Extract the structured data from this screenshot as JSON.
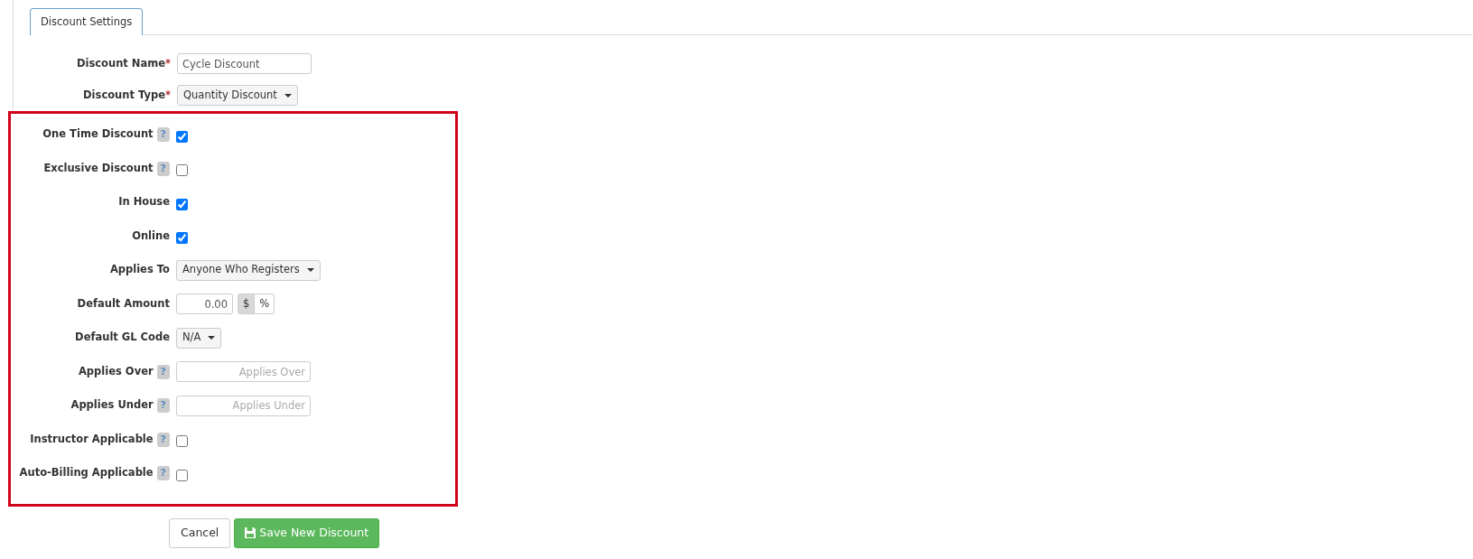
{
  "tabs": [
    {
      "label": "Discount Settings",
      "selected": true
    }
  ],
  "fields": [
    {
      "kind": "text",
      "label": "Discount Name",
      "required_mark": "*",
      "value": "Cycle Discount"
    },
    {
      "kind": "select",
      "label": "Discount Type",
      "required_mark": "*",
      "value": "Quantity Discount"
    }
  ],
  "highlighted_section": {
    "fields": [
      {
        "kind": "checkbox",
        "label": "One Time Discount",
        "help": "?",
        "checked": true
      },
      {
        "kind": "checkbox",
        "label": "Exclusive Discount",
        "help": "?",
        "checked": false
      },
      {
        "kind": "checkbox",
        "label": "In House",
        "checked": true
      },
      {
        "kind": "checkbox",
        "label": "Online",
        "checked": true
      },
      {
        "kind": "select",
        "label": "Applies To",
        "value": "Anyone Who Registers"
      },
      {
        "kind": "amount",
        "label": "Default Amount",
        "value": "0.00",
        "units": [
          {
            "label": "$",
            "selected": true
          },
          {
            "label": "%",
            "selected": false
          }
        ]
      },
      {
        "kind": "select",
        "label": "Default GL Code",
        "value": "N/A"
      },
      {
        "kind": "number",
        "label": "Applies Over",
        "help": "?",
        "placeholder": "Applies Over"
      },
      {
        "kind": "number",
        "label": "Applies Under",
        "help": "?",
        "placeholder": "Applies Under"
      },
      {
        "kind": "checkbox",
        "label": "Instructor Applicable",
        "help": "?",
        "checked": false
      },
      {
        "kind": "checkbox",
        "label": "Auto-Billing Applicable",
        "help": "?",
        "checked": false
      }
    ]
  },
  "buttons": [
    {
      "kind": "default",
      "label": "Cancel"
    },
    {
      "kind": "save",
      "label": "Save New Discount"
    }
  ]
}
